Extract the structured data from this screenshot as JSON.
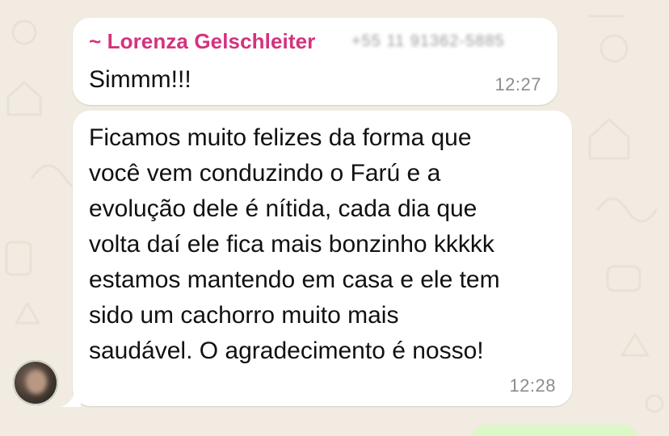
{
  "chat": {
    "messages": [
      {
        "sender_name": "~ Lorenza Gelschleiter",
        "sender_phone": "+55 11 91362-5885",
        "text": "Simmm!!!",
        "time": "12:27"
      },
      {
        "lines": [
          "Ficamos muito felizes da forma que",
          "você vem conduzindo o Farú e a",
          "evolução dele é nítida, cada dia que",
          "volta daí ele fica mais bonzinho kkkkk",
          "estamos mantendo em casa e ele tem",
          "sido um cachorro muito mais",
          "saudável. O agradecimento é nosso!"
        ],
        "time": "12:28"
      }
    ]
  },
  "colors": {
    "background": "#f1ebe2",
    "bubble_incoming": "#ffffff",
    "bubble_outgoing": "#dcf8c6",
    "sender_name": "#d3337d",
    "timestamp": "#8c8c8c"
  },
  "icons": {
    "avatar": "contact-avatar-photo"
  }
}
